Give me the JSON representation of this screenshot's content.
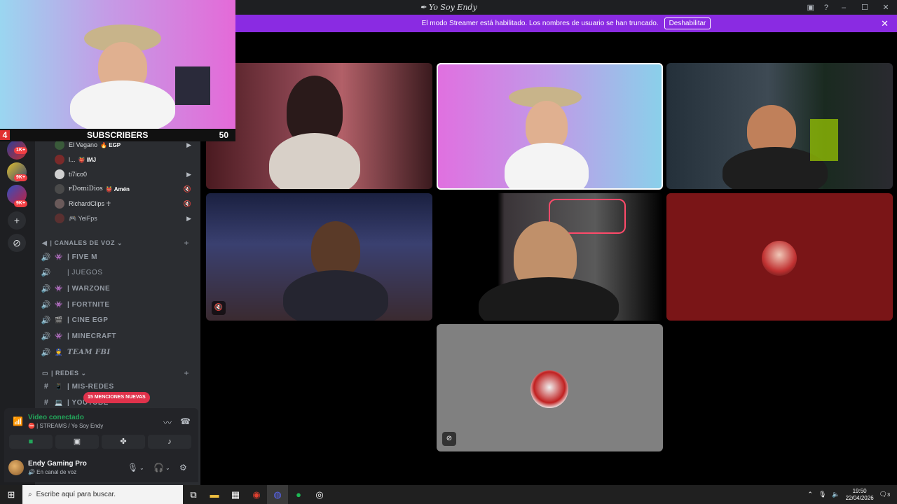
{
  "window": {
    "title": "✒ Yo Soy Endy",
    "controls": {
      "minimize": "–",
      "maximize": "☐",
      "close": "✕"
    }
  },
  "banner": {
    "text": "El modo Streamer está habilitado. Los nombres de usuario se han truncado.",
    "button": "Deshabilitar",
    "close": "✕"
  },
  "overlay": {
    "left_count": "4",
    "label": "SUBSCRIBERS",
    "right_count": "50"
  },
  "rail": {
    "pings": [
      "1K+",
      "9K+",
      "9K+"
    ],
    "add": "+",
    "discover": "⊘"
  },
  "voice_users": [
    {
      "name": "El Vegano",
      "tag": "🔥 EGP",
      "icon": "▶"
    },
    {
      "name": "l...",
      "tag": "👹 IMJ",
      "icon": ""
    },
    {
      "name": "ti7ico0",
      "tag": "",
      "icon": "▶"
    },
    {
      "name": "ꜰDomiDios",
      "tag": "👹 Amén",
      "icon": "🔇"
    },
    {
      "name": "RichardClips ☥",
      "tag": "",
      "icon": "🔇"
    },
    {
      "name": "🎮 YeiFps",
      "tag": "",
      "icon": "▶"
    }
  ],
  "voice_category": {
    "label": "| CANALES DE VOZ ⌄",
    "plus": "+"
  },
  "voice_channels": [
    {
      "emoji": "👾",
      "label": "| FIVE M"
    },
    {
      "emoji": "",
      "label": "| JUEGOS"
    },
    {
      "emoji": "👾",
      "label": "| WARZONE"
    },
    {
      "emoji": "👾",
      "label": "| FORTNITE"
    },
    {
      "emoji": "🎬",
      "label": "| CINE EGP"
    },
    {
      "emoji": "👾",
      "label": "| MINECRAFT"
    },
    {
      "emoji": "👮",
      "label": "TEAM FBI"
    }
  ],
  "redes_category": {
    "label": "| REDES ⌄",
    "plus": "+"
  },
  "text_channels": [
    {
      "emoji": "📱",
      "label": "| MIS-REDES"
    },
    {
      "emoji": "💻",
      "label": "| YOUTUBE"
    }
  ],
  "mention_pill": "15 MENCIONES NUEVAS",
  "voice_panel": {
    "status": "Video conectado",
    "channel": "⛔ | STREAMS / Yo Soy Endy",
    "buttons": [
      "camera",
      "screen",
      "activities",
      "soundboard"
    ]
  },
  "user_panel": {
    "name": "Endy Gaming Pro",
    "status": "🔊 En canal de voz"
  },
  "tiles": [
    {
      "name": "tile-streamer-female"
    },
    {
      "name": "tile-endy"
    },
    {
      "name": "tile-gamer-headset"
    },
    {
      "name": "tile-hoodie"
    },
    {
      "name": "tile-durag"
    },
    {
      "name": "tile-avatar-red"
    },
    {
      "name": "tile-avatar-gray"
    }
  ],
  "taskbar": {
    "search_placeholder": "Escribe aquí para buscar.",
    "time": "19:50",
    "date": "22/04/2026",
    "notifications": "3"
  },
  "colors": {
    "streamer_banner": "#8a2be2",
    "voice_connected": "#23a55a",
    "mention": "#e0324b",
    "active_speaker": "#ffffff",
    "red_tile": "#7a1517",
    "gray_tile": "#808080"
  }
}
